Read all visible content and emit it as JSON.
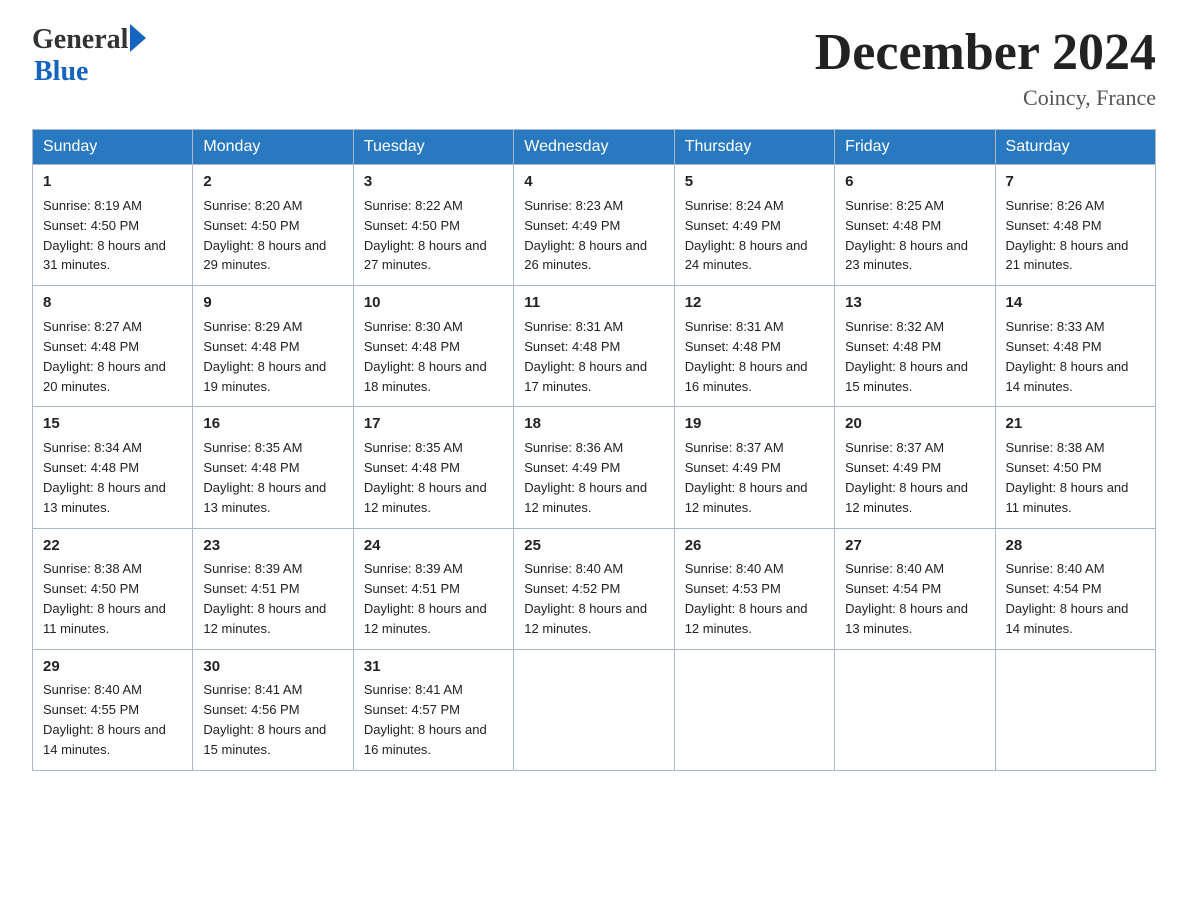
{
  "header": {
    "logo_general": "General",
    "logo_blue": "Blue",
    "month_title": "December 2024",
    "location": "Coincy, France"
  },
  "weekdays": [
    "Sunday",
    "Monday",
    "Tuesday",
    "Wednesday",
    "Thursday",
    "Friday",
    "Saturday"
  ],
  "weeks": [
    [
      {
        "day": "1",
        "sunrise": "8:19 AM",
        "sunset": "4:50 PM",
        "daylight": "8 hours and 31 minutes."
      },
      {
        "day": "2",
        "sunrise": "8:20 AM",
        "sunset": "4:50 PM",
        "daylight": "8 hours and 29 minutes."
      },
      {
        "day": "3",
        "sunrise": "8:22 AM",
        "sunset": "4:50 PM",
        "daylight": "8 hours and 27 minutes."
      },
      {
        "day": "4",
        "sunrise": "8:23 AM",
        "sunset": "4:49 PM",
        "daylight": "8 hours and 26 minutes."
      },
      {
        "day": "5",
        "sunrise": "8:24 AM",
        "sunset": "4:49 PM",
        "daylight": "8 hours and 24 minutes."
      },
      {
        "day": "6",
        "sunrise": "8:25 AM",
        "sunset": "4:48 PM",
        "daylight": "8 hours and 23 minutes."
      },
      {
        "day": "7",
        "sunrise": "8:26 AM",
        "sunset": "4:48 PM",
        "daylight": "8 hours and 21 minutes."
      }
    ],
    [
      {
        "day": "8",
        "sunrise": "8:27 AM",
        "sunset": "4:48 PM",
        "daylight": "8 hours and 20 minutes."
      },
      {
        "day": "9",
        "sunrise": "8:29 AM",
        "sunset": "4:48 PM",
        "daylight": "8 hours and 19 minutes."
      },
      {
        "day": "10",
        "sunrise": "8:30 AM",
        "sunset": "4:48 PM",
        "daylight": "8 hours and 18 minutes."
      },
      {
        "day": "11",
        "sunrise": "8:31 AM",
        "sunset": "4:48 PM",
        "daylight": "8 hours and 17 minutes."
      },
      {
        "day": "12",
        "sunrise": "8:31 AM",
        "sunset": "4:48 PM",
        "daylight": "8 hours and 16 minutes."
      },
      {
        "day": "13",
        "sunrise": "8:32 AM",
        "sunset": "4:48 PM",
        "daylight": "8 hours and 15 minutes."
      },
      {
        "day": "14",
        "sunrise": "8:33 AM",
        "sunset": "4:48 PM",
        "daylight": "8 hours and 14 minutes."
      }
    ],
    [
      {
        "day": "15",
        "sunrise": "8:34 AM",
        "sunset": "4:48 PM",
        "daylight": "8 hours and 13 minutes."
      },
      {
        "day": "16",
        "sunrise": "8:35 AM",
        "sunset": "4:48 PM",
        "daylight": "8 hours and 13 minutes."
      },
      {
        "day": "17",
        "sunrise": "8:35 AM",
        "sunset": "4:48 PM",
        "daylight": "8 hours and 12 minutes."
      },
      {
        "day": "18",
        "sunrise": "8:36 AM",
        "sunset": "4:49 PM",
        "daylight": "8 hours and 12 minutes."
      },
      {
        "day": "19",
        "sunrise": "8:37 AM",
        "sunset": "4:49 PM",
        "daylight": "8 hours and 12 minutes."
      },
      {
        "day": "20",
        "sunrise": "8:37 AM",
        "sunset": "4:49 PM",
        "daylight": "8 hours and 12 minutes."
      },
      {
        "day": "21",
        "sunrise": "8:38 AM",
        "sunset": "4:50 PM",
        "daylight": "8 hours and 11 minutes."
      }
    ],
    [
      {
        "day": "22",
        "sunrise": "8:38 AM",
        "sunset": "4:50 PM",
        "daylight": "8 hours and 11 minutes."
      },
      {
        "day": "23",
        "sunrise": "8:39 AM",
        "sunset": "4:51 PM",
        "daylight": "8 hours and 12 minutes."
      },
      {
        "day": "24",
        "sunrise": "8:39 AM",
        "sunset": "4:51 PM",
        "daylight": "8 hours and 12 minutes."
      },
      {
        "day": "25",
        "sunrise": "8:40 AM",
        "sunset": "4:52 PM",
        "daylight": "8 hours and 12 minutes."
      },
      {
        "day": "26",
        "sunrise": "8:40 AM",
        "sunset": "4:53 PM",
        "daylight": "8 hours and 12 minutes."
      },
      {
        "day": "27",
        "sunrise": "8:40 AM",
        "sunset": "4:54 PM",
        "daylight": "8 hours and 13 minutes."
      },
      {
        "day": "28",
        "sunrise": "8:40 AM",
        "sunset": "4:54 PM",
        "daylight": "8 hours and 14 minutes."
      }
    ],
    [
      {
        "day": "29",
        "sunrise": "8:40 AM",
        "sunset": "4:55 PM",
        "daylight": "8 hours and 14 minutes."
      },
      {
        "day": "30",
        "sunrise": "8:41 AM",
        "sunset": "4:56 PM",
        "daylight": "8 hours and 15 minutes."
      },
      {
        "day": "31",
        "sunrise": "8:41 AM",
        "sunset": "4:57 PM",
        "daylight": "8 hours and 16 minutes."
      },
      null,
      null,
      null,
      null
    ]
  ]
}
